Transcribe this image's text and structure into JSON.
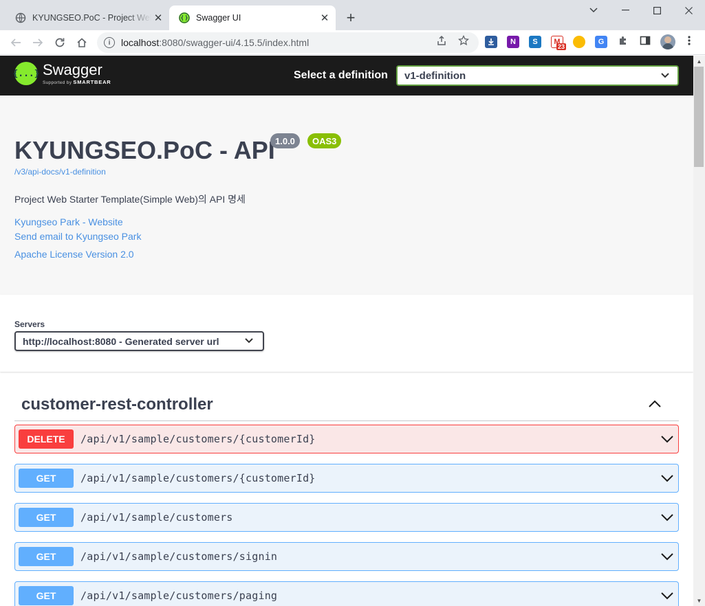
{
  "browser": {
    "tabs": [
      {
        "title": "KYUNGSEO.PoC - Project Web Starter",
        "active": false
      },
      {
        "title": "Swagger UI",
        "active": true
      }
    ],
    "new_tab_label": "+",
    "window_controls": {
      "minimize": "—",
      "maximize": "☐",
      "close": "✕",
      "tab_search": "⌄"
    },
    "url_host": "localhost",
    "url_rest": ":8080/swagger-ui/4.15.5/index.html",
    "extension_badge": "23"
  },
  "swagger": {
    "logo_text": "Swagger",
    "logo_sub_prefix": "Supported by",
    "logo_sub_brand": "SMARTBEAR",
    "logo_glyph": "{...}",
    "definition_label": "Select a definition",
    "definition_value": "v1-definition",
    "title": "KYUNGSEO.PoC - API",
    "version": "1.0.0",
    "oas": "OAS3",
    "spec_url": "/v3/api-docs/v1-definition",
    "description": "Project Web Starter Template(Simple Web)의 API 명세",
    "links": [
      "Kyungseo Park - Website",
      "Send email to Kyungseo Park",
      "Apache License Version 2.0"
    ],
    "servers_label": "Servers",
    "server_value": "http://localhost:8080 - Generated server url",
    "tag_title": "customer-rest-controller",
    "operations": [
      {
        "method": "DELETE",
        "path": "/api/v1/sample/customers/{customerId}"
      },
      {
        "method": "GET",
        "path": "/api/v1/sample/customers/{customerId}"
      },
      {
        "method": "GET",
        "path": "/api/v1/sample/customers"
      },
      {
        "method": "GET",
        "path": "/api/v1/sample/customers/signin"
      },
      {
        "method": "GET",
        "path": "/api/v1/sample/customers/paging"
      }
    ]
  },
  "colors": {
    "topbar": "#1b1b1b",
    "swagger_green": "#85ea2d",
    "delete": "#f93e3e",
    "get": "#61affe",
    "link": "#4990e2"
  }
}
